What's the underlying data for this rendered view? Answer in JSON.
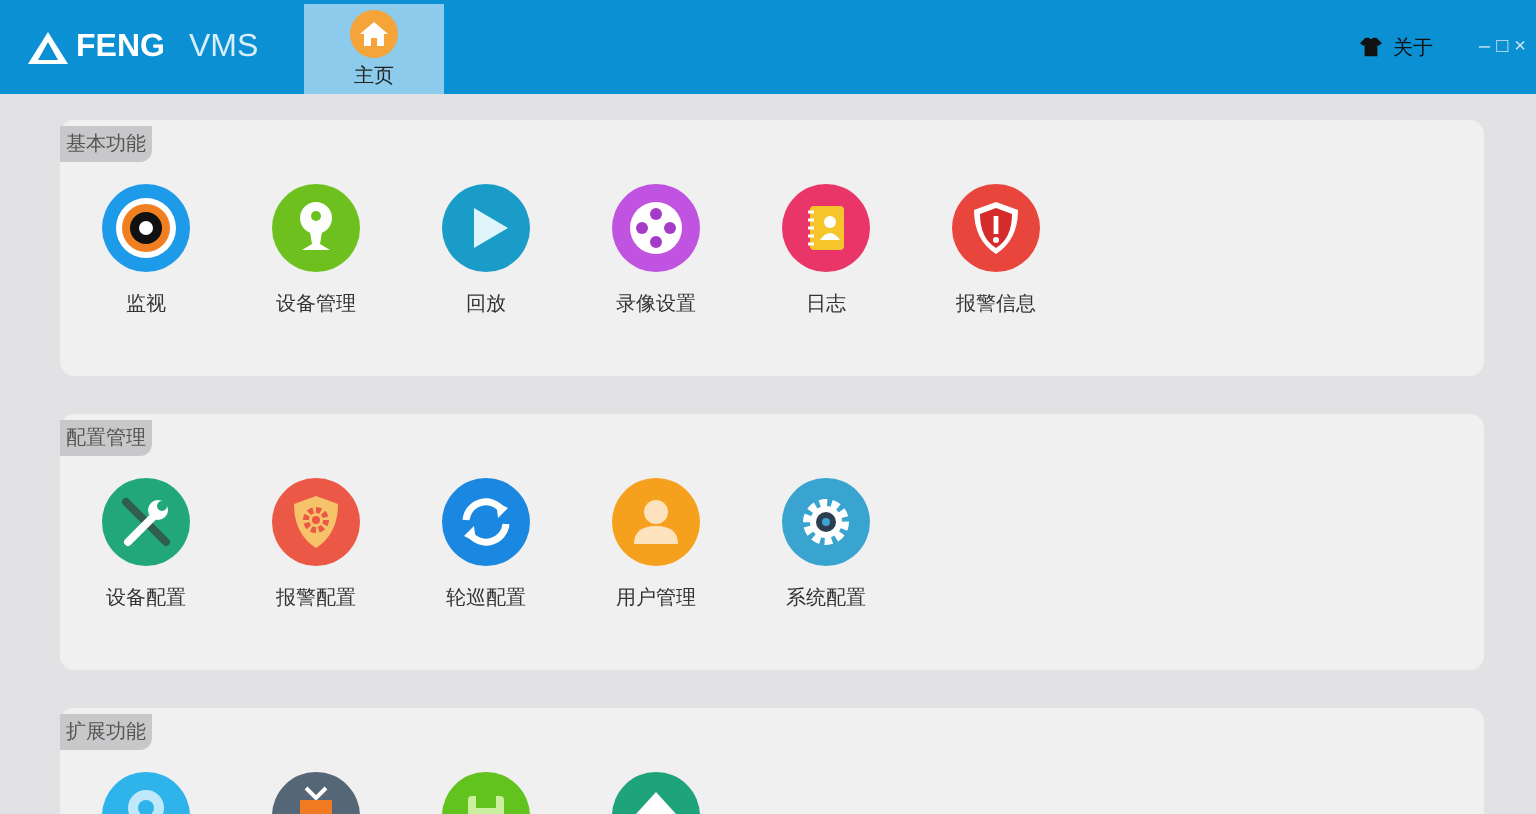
{
  "header": {
    "logo": "FENG",
    "app_name": "VMS",
    "tabs": [
      {
        "label": "主页",
        "selected": true
      }
    ],
    "about": "关于",
    "window_controls": [
      "–",
      "□",
      "×"
    ]
  },
  "sections": [
    {
      "title": "基本功能",
      "items": [
        {
          "kind": "lens",
          "label": "监视"
        },
        {
          "kind": "webcam",
          "label": "设备管理"
        },
        {
          "kind": "play",
          "label": "回放"
        },
        {
          "kind": "reel",
          "label": "录像设置"
        },
        {
          "kind": "book",
          "label": "日志"
        },
        {
          "kind": "alert",
          "label": "报警信息"
        }
      ]
    },
    {
      "title": "配置管理",
      "items": [
        {
          "kind": "tools",
          "label": "设备配置"
        },
        {
          "kind": "shieldgear",
          "label": "报警配置"
        },
        {
          "kind": "sync",
          "label": "轮巡配置"
        },
        {
          "kind": "user",
          "label": "用户管理"
        },
        {
          "kind": "gear",
          "label": "系统配置"
        }
      ]
    },
    {
      "title": "扩展功能",
      "items": [
        {
          "kind": "camera"
        },
        {
          "kind": "tv"
        },
        {
          "kind": "floppy"
        },
        {
          "kind": "upload"
        }
      ]
    }
  ]
}
